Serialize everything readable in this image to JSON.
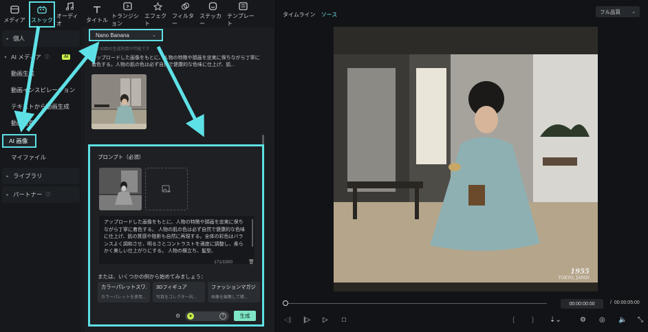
{
  "toolbar": {
    "items": [
      {
        "label": "メディア",
        "icon": "media-icon"
      },
      {
        "label": "ストック",
        "icon": "stock-icon",
        "active": true
      },
      {
        "label": "オーディオ",
        "icon": "music-icon"
      },
      {
        "label": "タイトル",
        "icon": "title-icon"
      },
      {
        "label": "トランジション",
        "icon": "transition-icon"
      },
      {
        "label": "エフェクト",
        "icon": "effect-icon"
      },
      {
        "label": "フィルター",
        "icon": "filter-icon"
      },
      {
        "label": "ステッカー",
        "icon": "sticker-icon"
      },
      {
        "label": "テンプレート",
        "icon": "template-icon"
      }
    ]
  },
  "sidebar": {
    "personal": "個人",
    "ai_media": "AI メディア",
    "ai_badge": "AI",
    "sub_items": [
      "動画生成",
      "動画インスピレーション",
      "テキストから動画生成",
      "動画延長"
    ],
    "ai_image": "AI 画像",
    "my_files": "マイファイル",
    "library": "ライブラリ",
    "partner": "パートナー"
  },
  "middle": {
    "model": "Nano Banana",
    "model_note": "残り30回の生成利用が可能です",
    "description": "アップロードした画像をもとに、人物の特徴や顔画を忠実に保ちながら丁寧に着色する。人物の肌の色は必ず自然で健康的な色味に仕上げ、肌...",
    "prompt_label": "プロンプト（必須）",
    "prompt_text": "アップロードした画像をもとに、人物の特徴や顔画を忠実に保ちながら丁寧に着色する。 人物の肌の色は必ず自然で健康的な色味に仕上げ、肌の質感や陰影も自然に再現する。全体の彩色はバランスよく調和させ、明るさとコントラストを適度に調整し、柔らかく美しい仕上がりにする。 人物の横立ち、髪型、",
    "counter": "171/1500",
    "examples_label": "または、いくつかの例から始めてみましょう：",
    "examples": [
      {
        "title": "カラーパレットスワ...",
        "sub": "カラーパレットを使用..."
      },
      {
        "title": "3Dフィギュア",
        "sub": "写真をコレクター向..."
      },
      {
        "title": "ファッションマガジン",
        "sub": "画像を編集して雑..."
      }
    ],
    "generate": "生成"
  },
  "viewer": {
    "tab_timeline": "タイムライン",
    "tab_source": "ソース",
    "quality": "フル品質",
    "timecode": "00:00:00:00",
    "separator": "/",
    "total": "00:00:05:00",
    "watermark_year": "1955",
    "watermark_place": "TOKYO, JAPAN"
  }
}
